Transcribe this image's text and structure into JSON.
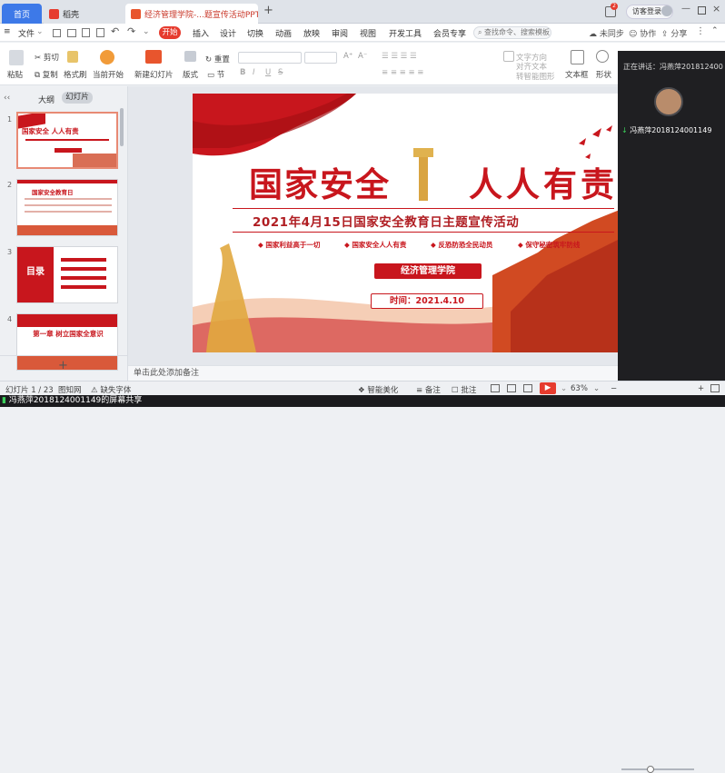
{
  "tabs": {
    "home": "首页",
    "docer": "稻壳",
    "doc": "经济管理学院-...题宣传活动PPT",
    "new_tab": "+",
    "badge": "2",
    "visitor_login": "访客登录"
  },
  "menu": {
    "file": "文件",
    "start": "开始",
    "items": [
      "插入",
      "设计",
      "切换",
      "动画",
      "放映",
      "审阅",
      "视图",
      "开发工具",
      "会员专享"
    ],
    "search": "查找命令、搜索模板",
    "sync": "未同步",
    "collab": "协作",
    "share": "分享"
  },
  "ribbon": {
    "paste": "粘贴",
    "cut": "剪切",
    "copy": "复制",
    "format_painter": "格式刷",
    "from_current": "当前开始",
    "new_slide": "新建幻灯片",
    "layout": "版式",
    "section": "节",
    "reset": "重置",
    "text_frame": "文本框",
    "shape": "形状",
    "convert_smart": "转智能图形",
    "text_direction": "文字方向",
    "align_text": "对齐文本",
    "bold": "B",
    "italic": "I",
    "underline": "U",
    "strike": "S"
  },
  "panel": {
    "outline": "大纲",
    "slides": "幻灯片",
    "add_slide": "+"
  },
  "thumbnails": [
    {
      "num": "1",
      "title": "国家安全   人人有责"
    },
    {
      "num": "2",
      "title": "国家安全教育日"
    },
    {
      "num": "3",
      "title": "目录"
    },
    {
      "num": "4",
      "title": "第一章  树立国家全意识"
    }
  ],
  "slide": {
    "title_left": "国家安全",
    "title_right": "人人有责",
    "subtitle": "2021年4月15日国家安全教育日主题宣传活动",
    "slogans": [
      "国家利益高于一切",
      "国家安全人人有责",
      "反恐防恐全民动员",
      "保守秘密筑牢防线"
    ],
    "org": "经济管理学院",
    "time": "时间：2021.4.10"
  },
  "notes": "单击此处添加备注",
  "right": {
    "speaking": "正在讲话：冯燕萍2018124001...",
    "user": "冯燕萍2018124001149"
  },
  "status": {
    "slide_count": "幻灯片 1 / 23",
    "theme": "图知网",
    "missing_font": "缺失字体",
    "smart_beautify": "智能美化",
    "notes": "备注",
    "comment": "批注",
    "zoom": "63%"
  },
  "share_text": "冯燕萍2018124001149的屏幕共享",
  "colors": {
    "accent_red": "#e63b2e",
    "slide_red": "#c8161d",
    "gold": "#d9a441",
    "tab_blue": "#3d79e8"
  }
}
